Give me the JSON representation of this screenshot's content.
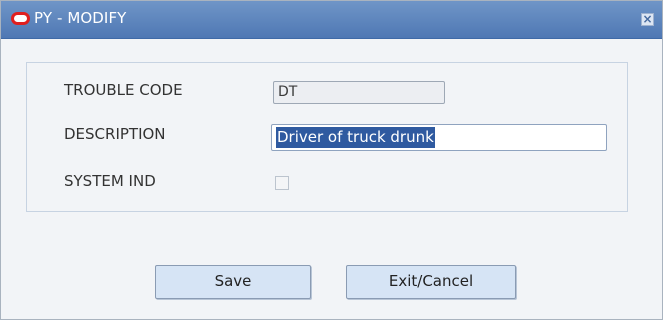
{
  "window": {
    "title": "PY - MODIFY"
  },
  "form": {
    "trouble_code": {
      "label": "TROUBLE CODE",
      "value": "DT"
    },
    "description": {
      "label": "DESCRIPTION",
      "value": "Driver of truck drunk"
    },
    "system_ind": {
      "label": "SYSTEM IND",
      "checked": false
    }
  },
  "buttons": {
    "save_label": "Save",
    "exit_label": "Exit/Cancel"
  },
  "colors": {
    "titlebar": "#5a82bb",
    "selection": "#2f5aa0",
    "button_bg": "#d6e4f5",
    "logo": "#e01f1f"
  }
}
